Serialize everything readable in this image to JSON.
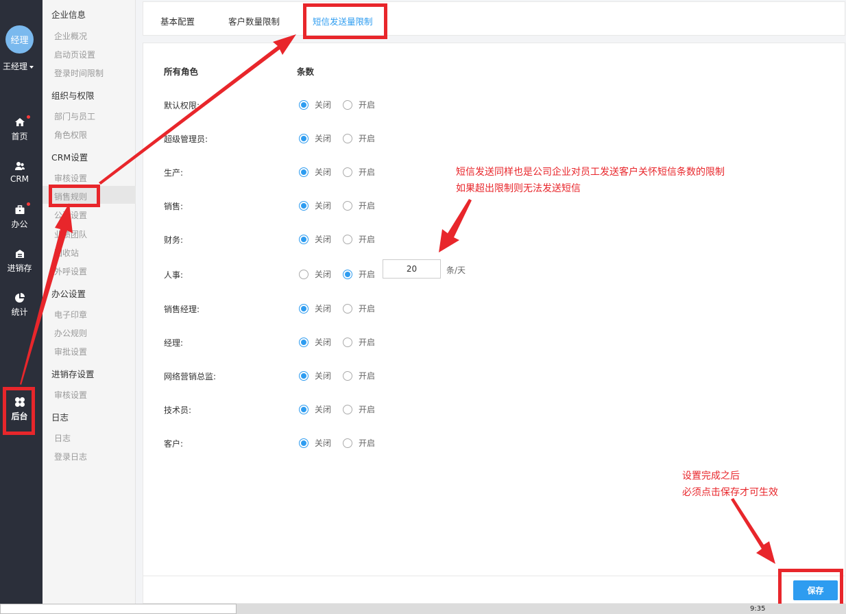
{
  "rail": {
    "avatar_text": "经理",
    "user_name": "王经理",
    "items": [
      {
        "label": "首页",
        "icon": "home-icon"
      },
      {
        "label": "CRM",
        "icon": "users-icon"
      },
      {
        "label": "办公",
        "icon": "briefcase-icon"
      },
      {
        "label": "进销存",
        "icon": "warehouse-icon"
      },
      {
        "label": "统计",
        "icon": "pie-chart-icon"
      },
      {
        "label": "后台",
        "icon": "grid-icon"
      }
    ]
  },
  "sidebar": {
    "groups": [
      {
        "title": "企业信息",
        "items": [
          "企业概况",
          "启动页设置",
          "登录时间限制"
        ]
      },
      {
        "title": "组织与权限",
        "items": [
          "部门与员工",
          "角色权限"
        ]
      },
      {
        "title": "CRM设置",
        "items": [
          "审核设置",
          "销售规则",
          "公海设置",
          "业绩团队",
          "回收站",
          "外呼设置"
        ]
      },
      {
        "title": "办公设置",
        "items": [
          "电子印章",
          "办公规则",
          "审批设置"
        ]
      },
      {
        "title": "进销存设置",
        "items": [
          "审核设置"
        ]
      },
      {
        "title": "日志",
        "items": [
          "日志",
          "登录日志"
        ]
      }
    ],
    "active_item": "销售规则"
  },
  "tabs": [
    "基本配置",
    "客户数量限制",
    "短信发送量限制"
  ],
  "active_tab": "短信发送量限制",
  "table": {
    "header_role": "所有角色",
    "header_count": "条数",
    "option_off": "关闭",
    "option_on": "开启",
    "unit": "条/天",
    "rows": [
      {
        "role": "默认权限:",
        "state": "off"
      },
      {
        "role": "超级管理员:",
        "state": "off"
      },
      {
        "role": "生产:",
        "state": "off"
      },
      {
        "role": "销售:",
        "state": "off"
      },
      {
        "role": "财务:",
        "state": "off"
      },
      {
        "role": "人事:",
        "state": "on",
        "limit": "20"
      },
      {
        "role": "销售经理:",
        "state": "off"
      },
      {
        "role": "经理:",
        "state": "off"
      },
      {
        "role": "网络营销总监:",
        "state": "off"
      },
      {
        "role": "技术员:",
        "state": "off"
      },
      {
        "role": "客户:",
        "state": "off"
      }
    ]
  },
  "save_label": "保存",
  "annotations": {
    "note1_line1": "短信发送同样也是公司企业对员工发送客户关怀短信条数的限制",
    "note1_line2": "如果超出限制则无法发送短信",
    "note2_line1": "设置完成之后",
    "note2_line2": "必须点击保存才可生效"
  },
  "taskbar": {
    "time": "9:35"
  },
  "colors": {
    "accent": "#2e9cf0",
    "annotation": "#e8262b",
    "rail": "#2b2f3a"
  }
}
